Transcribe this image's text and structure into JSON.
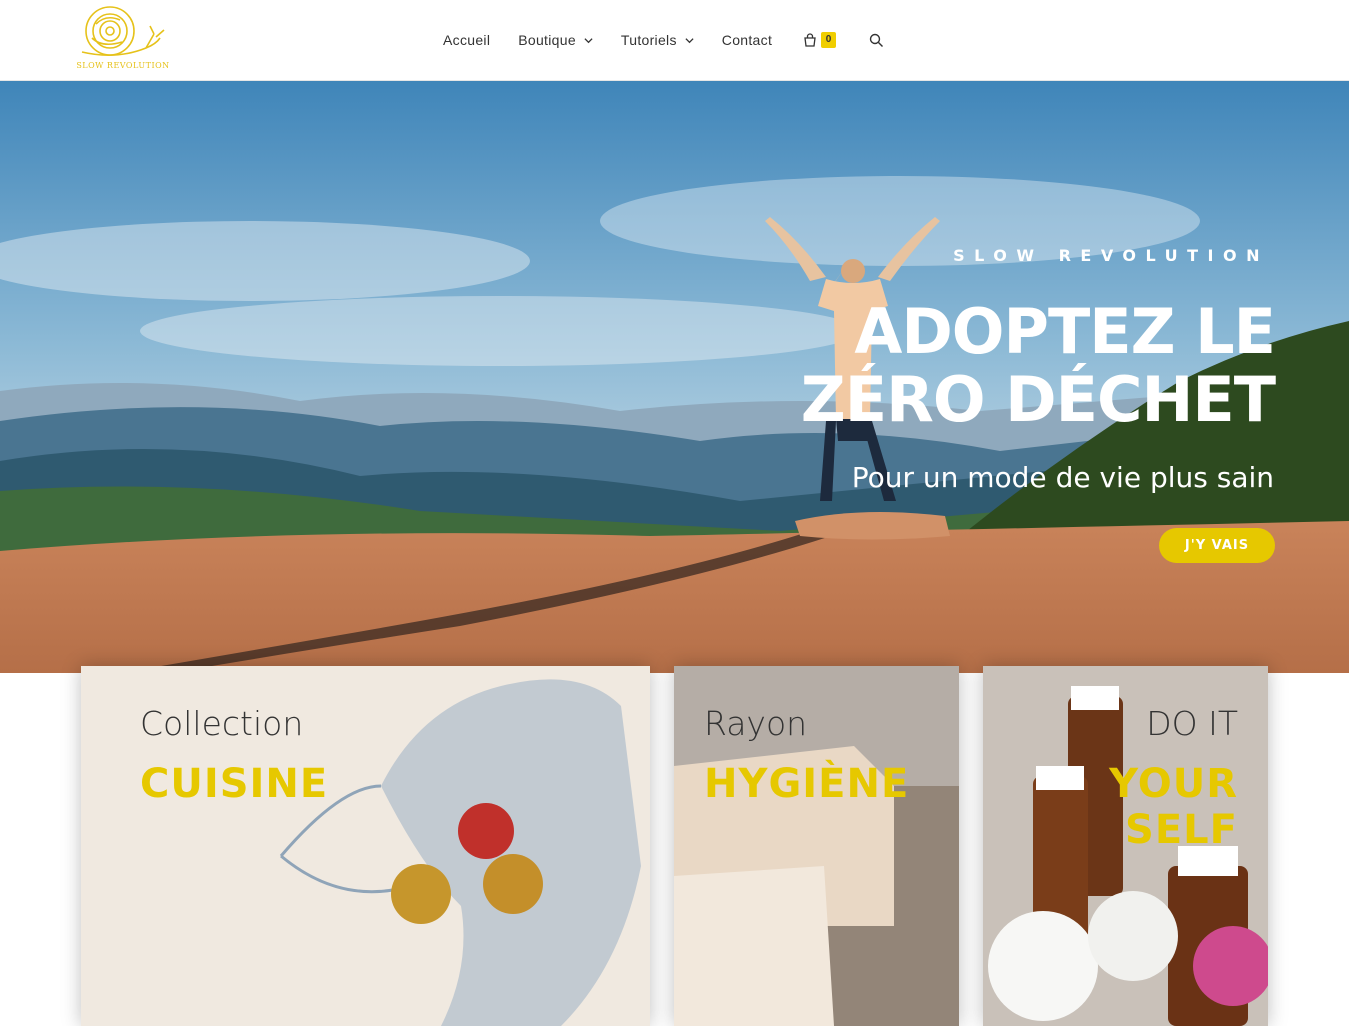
{
  "brand": {
    "logo_text": "SLOW REVOLUTION",
    "accent_color": "#e6c800"
  },
  "nav": {
    "items": [
      {
        "label": "Accueil"
      },
      {
        "label": "Boutique"
      },
      {
        "label": "Tutoriels"
      },
      {
        "label": "Contact"
      }
    ],
    "cart_icon": "shopping-bag-icon",
    "cart_count": "0",
    "search_icon": "search-icon"
  },
  "hero": {
    "kicker": "SLOW REVOLUTION",
    "title": "ADOPTEZ LE ZÉRO DÉCHET",
    "subtitle": "Pour un mode de vie plus sain",
    "button_label": "J'Y VAIS"
  },
  "cards": [
    {
      "label": "Collection",
      "accent": "CUISINE"
    },
    {
      "label": "Rayon",
      "accent": "HYGIÈNE"
    },
    {
      "label": "DO IT",
      "accent_line1": "YOUR",
      "accent_line2": "SELF"
    }
  ]
}
